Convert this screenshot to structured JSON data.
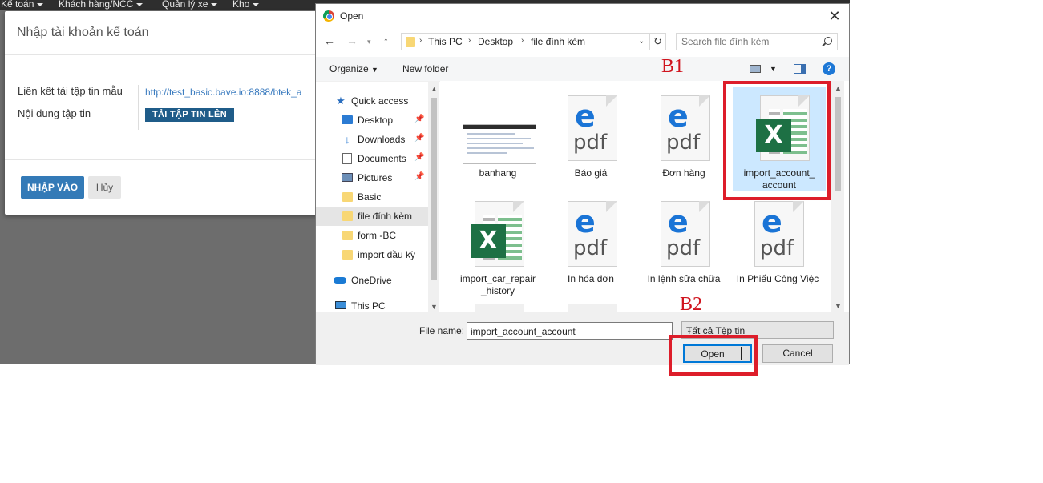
{
  "app": {
    "nav": [
      {
        "label": "Kế toán"
      },
      {
        "label": "Khách hàng/NCC"
      },
      {
        "label": "Quản lý xe"
      },
      {
        "label": "Kho"
      }
    ]
  },
  "modal": {
    "title": "Nhập tài khoản kế toán",
    "template_label": "Liên kết tải tập tin mẫu",
    "template_link": "http://test_basic.bave.io:8888/btek_a",
    "content_label": "Nội dung tập tin",
    "upload_label": "TẢI TẬP TIN LÊN",
    "import_label": "NHẬP VÀO",
    "cancel_label": "Hủy"
  },
  "dialog": {
    "title": "Open",
    "breadcrumb": [
      "This PC",
      "Desktop",
      "file đính kèm"
    ],
    "search_placeholder": "Search file đính kèm",
    "organize_label": "Organize",
    "new_folder_label": "New folder",
    "nav_items": [
      {
        "label": "Quick access",
        "icon": "star-icon",
        "pinned": false
      },
      {
        "label": "Desktop",
        "icon": "desktop-icon",
        "pinned": true
      },
      {
        "label": "Downloads",
        "icon": "download-icon",
        "pinned": true
      },
      {
        "label": "Documents",
        "icon": "documents-icon",
        "pinned": true
      },
      {
        "label": "Pictures",
        "icon": "pictures-icon",
        "pinned": true
      },
      {
        "label": "Basic",
        "icon": "folder-icon",
        "pinned": false
      },
      {
        "label": "file đính kèm",
        "icon": "folder-icon",
        "pinned": false
      },
      {
        "label": "form -BC",
        "icon": "folder-icon",
        "pinned": false
      },
      {
        "label": "import đầu kỳ",
        "icon": "folder-icon",
        "pinned": false
      },
      {
        "label": "OneDrive",
        "icon": "onedrive-icon",
        "pinned": false
      },
      {
        "label": "This PC",
        "icon": "this-pc-icon",
        "pinned": false
      }
    ],
    "files": [
      {
        "name": "banhang",
        "type": "image"
      },
      {
        "name": "Báo giá",
        "type": "pdf"
      },
      {
        "name": "Đơn hàng",
        "type": "pdf"
      },
      {
        "name": "import_account_ account",
        "type": "excel"
      },
      {
        "name": "import_car_repair _history",
        "type": "excel"
      },
      {
        "name": "In hóa đơn",
        "type": "pdf"
      },
      {
        "name": "In lệnh sửa chữa",
        "type": "pdf"
      },
      {
        "name": "In Phiếu Công Việc",
        "type": "pdf"
      }
    ],
    "pdf_glyph": "e",
    "pdf_text": "pdf",
    "excel_glyph": "X",
    "file_name_label": "File name:",
    "file_name_value": "import_account_account",
    "file_type_value": "Tất cả Tệp tin",
    "open_label": "Open",
    "cancel_label": "Cancel"
  },
  "annotations": {
    "b1": "B1",
    "b2": "B2",
    "highlight_color": "#dd1d2a"
  }
}
